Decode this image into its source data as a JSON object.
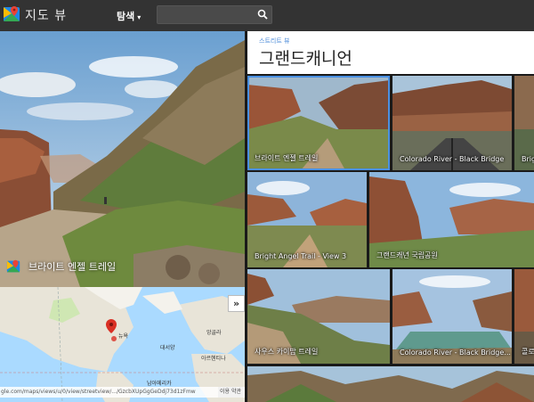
{
  "header": {
    "app_title": "지도 뷰",
    "explore_label": "탐색",
    "search_placeholder": ""
  },
  "hero": {
    "caption": "브라이트 엔젤 트레일"
  },
  "map": {
    "labels": [
      "뉴욕",
      "대서양",
      "아르헨티나",
      "남아메리카",
      "앙골라"
    ],
    "url": "gle.com/maps/views/u/0/view/streetview/.../GzcbXUpGgGeDdj73d1zFmw",
    "terms": "이용 약관"
  },
  "panel": {
    "breadcrumb": "스트리트 뷰",
    "title": "그랜드캐니언",
    "tiles": [
      {
        "label": "브라이트 엔젤 트레일"
      },
      {
        "label": "Colorado River - Black Bridge"
      },
      {
        "label": "Brig"
      },
      {
        "label": "Bright Angel Trail - View 3"
      },
      {
        "label": "그랜드캐년 국립공원"
      },
      {
        "label": "사우스 카이밥 트레일"
      },
      {
        "label": "Colorado River - Black Bridge..."
      },
      {
        "label": "콜로"
      }
    ]
  },
  "colors": {
    "topbar": "#333333",
    "accent": "#4a90e2"
  },
  "icons": {
    "logo": "maps-logo-icon",
    "search": "search-icon",
    "expand": "chevron-right-icon",
    "pin": "map-pin-icon"
  }
}
